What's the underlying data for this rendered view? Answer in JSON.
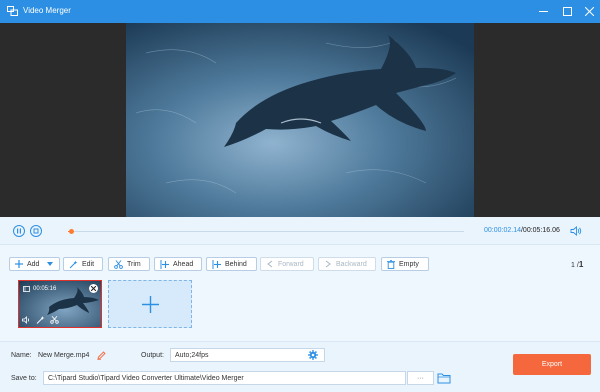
{
  "window": {
    "title": "Video Merger",
    "accent": "#2c8fe4",
    "icons": [
      "merge-app-icon",
      "minimize-icon",
      "maximize-icon",
      "close-icon"
    ]
  },
  "player": {
    "current_time": "00:00:02.14",
    "total_time": "/00:05:16.06",
    "progress": 0.007,
    "progress_color": "#ff7b2f"
  },
  "toolbar": {
    "add": "Add",
    "edit": "Edit",
    "trim": "Trim",
    "ahead": "Ahead",
    "behind": "Behind",
    "forward": "Forward",
    "backward": "Backward",
    "empty": "Empty",
    "page_current": "1",
    "page_sep": "/",
    "page_total": "1"
  },
  "clips": [
    {
      "duration": "00:05:16",
      "selected": true
    }
  ],
  "bottom": {
    "name_label": "Name:",
    "name_value": "New Merge.mp4",
    "output_label": "Output:",
    "output_value": "Auto;24fps",
    "save_label": "Save to:",
    "save_path": "C:\\Tipard Studio\\Tipard Video Converter Ultimate\\Video Merger",
    "browse_label": "···",
    "export_label": "Export",
    "export_color": "#f5683d"
  }
}
